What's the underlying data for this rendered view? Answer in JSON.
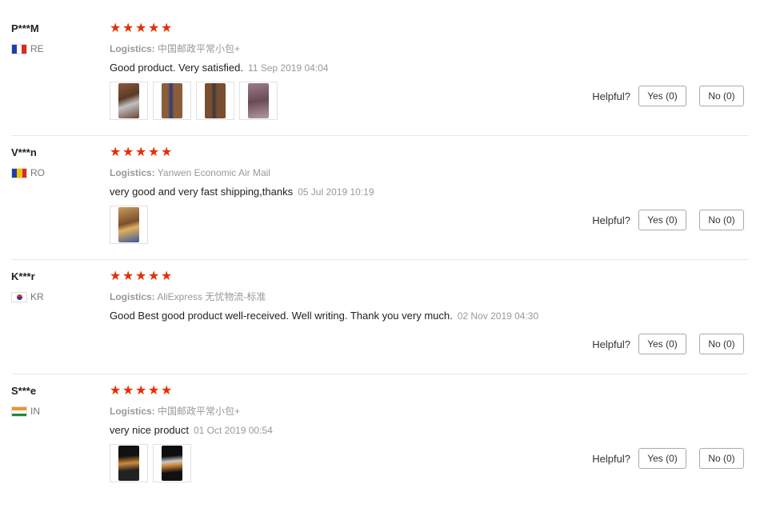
{
  "helpful_label": "Helpful?",
  "reviews": [
    {
      "user": "P***M",
      "country": "RE",
      "rating": 5,
      "logistics_label": "Logistics:",
      "logistics": "中国邮政平常小包+",
      "text": "Good product. Very satisfied.",
      "date": "11 Sep 2019 04:04",
      "photos": 4,
      "yes": "Yes (0)",
      "no": "No (0)"
    },
    {
      "user": "V***n",
      "country": "RO",
      "rating": 5,
      "logistics_label": "Logistics:",
      "logistics": "Yanwen Economic Air Mail",
      "text": "very good and very fast shipping,thanks",
      "date": "05 Jul 2019 10:19",
      "photos": 1,
      "yes": "Yes (0)",
      "no": "No (0)"
    },
    {
      "user": "K***r",
      "country": "KR",
      "rating": 5,
      "logistics_label": "Logistics:",
      "logistics": "AliExpress 无忧物流-标准",
      "text": "Good Best good product well-received. Well writing. Thank you very much.",
      "date": "02 Nov 2019 04:30",
      "photos": 0,
      "yes": "Yes (0)",
      "no": "No (0)"
    },
    {
      "user": "S***e",
      "country": "IN",
      "rating": 5,
      "logistics_label": "Logistics:",
      "logistics": "中国邮政平常小包+",
      "text": "very nice product",
      "date": "01 Oct 2019 00:54",
      "photos": 2,
      "yes": "Yes (0)",
      "no": "No (0)"
    }
  ],
  "colors": {
    "star": "#e62e04",
    "muted_text": "#999999",
    "divider": "#e8e8e8"
  }
}
